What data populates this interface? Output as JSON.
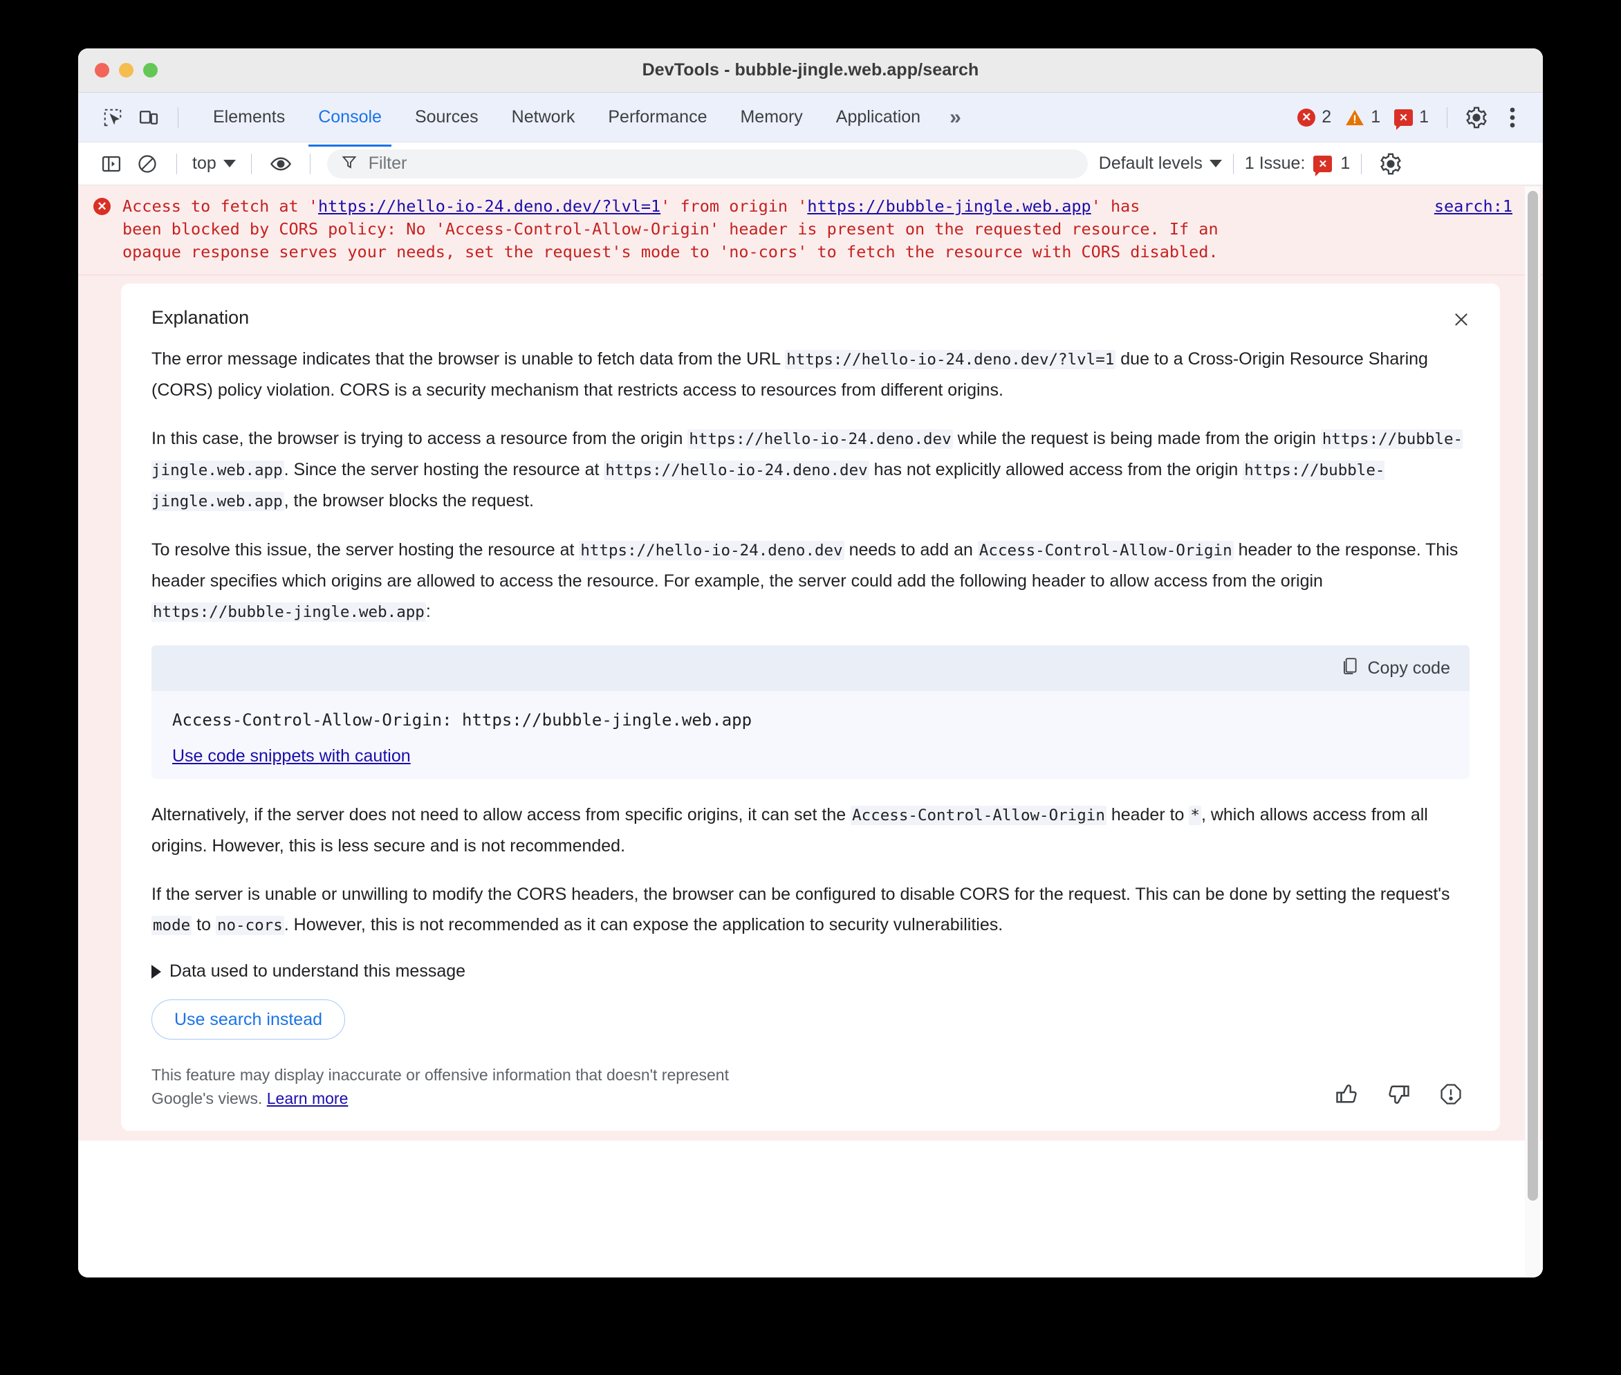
{
  "window": {
    "title": "DevTools - bubble-jingle.web.app/search",
    "traffic_lights": [
      "close",
      "minimize",
      "zoom"
    ]
  },
  "tabbar": {
    "icons": [
      "inspect-element-icon",
      "device-toolbar-icon"
    ],
    "tabs": [
      {
        "label": "Elements",
        "active": false
      },
      {
        "label": "Console",
        "active": true
      },
      {
        "label": "Sources",
        "active": false
      },
      {
        "label": "Network",
        "active": false
      },
      {
        "label": "Performance",
        "active": false
      },
      {
        "label": "Memory",
        "active": false
      },
      {
        "label": "Application",
        "active": false
      }
    ],
    "overflow": "»",
    "counters": {
      "errors": "2",
      "warnings": "1",
      "issues": "1",
      "error_glyph": "✕",
      "issue_glyph": "✕"
    },
    "settings_icon": "gear-icon",
    "more_icon": "kebab-menu-icon"
  },
  "console_toolbar": {
    "sidebar_toggle": "show-console-sidebar-icon",
    "clear_console": "clear-console-icon",
    "context": "top",
    "eye_icon": "live-expression-icon",
    "filter_placeholder": "Filter",
    "filter_value": "",
    "levels": "Default levels",
    "issues_text": "1 Issue:",
    "issues_count": "1",
    "settings_icon": "gear-icon"
  },
  "console_message": {
    "line1_pre": "Access to fetch at '",
    "link1": "https://hello-io-24.deno.dev/?lvl=1",
    "line1_mid": "' from origin '",
    "link2": "https://bubble-jingle.web.app",
    "line1_post": "' has",
    "line2": "been blocked by CORS policy: No 'Access-Control-Allow-Origin' header is present on the requested resource. If an",
    "line3": "opaque response serves your needs, set the request's mode to 'no-cors' to fetch the resource with CORS disabled.",
    "source_link": "search:1"
  },
  "insight": {
    "title": "Explanation",
    "close_label": "×",
    "p1_a": "The error message indicates that the browser is unable to fetch data from the URL ",
    "p1_code": "https://hello-io-24.deno.dev/?lvl=1",
    "p1_b": " due to a Cross-Origin Resource Sharing (CORS) policy violation. CORS is a security mechanism that restricts access to resources from different origins.",
    "p2_a": "In this case, the browser is trying to access a resource from the origin ",
    "p2_code1": "https://hello-io-24.deno.dev",
    "p2_b": " while the request is being made from the origin ",
    "p2_code2": "https://bubble-jingle.web.app",
    "p2_c": ". Since the server hosting the resource at ",
    "p2_code3": "https://hello-io-24.deno.dev",
    "p2_d": " has not explicitly allowed access from the origin ",
    "p2_code4": "https://bubble-jingle.web.app",
    "p2_e": ", the browser blocks the request.",
    "p3_a": "To resolve this issue, the server hosting the resource at ",
    "p3_code1": "https://hello-io-24.deno.dev",
    "p3_b": " needs to add an ",
    "p3_code2": "Access-Control-Allow-Origin",
    "p3_c": " header to the response. This header specifies which origins are allowed to access the resource. For example, the server could add the following header to allow access from the origin ",
    "p3_code3": "https://bubble-jingle.web.app",
    "p3_d": ":",
    "code_block": {
      "copy_label": "Copy code",
      "copy_icon": "copy-icon",
      "content": "Access-Control-Allow-Origin: https://bubble-jingle.web.app",
      "caution_link": "Use code snippets with caution"
    },
    "p4_a": "Alternatively, if the server does not need to allow access from specific origins, it can set the ",
    "p4_code1": "Access-Control-Allow-Origin",
    "p4_b": " header to ",
    "p4_code2": "*",
    "p4_c": ", which allows access from all origins. However, this is less secure and is not recommended.",
    "p5_a": "If the server is unable or unwilling to modify the CORS headers, the browser can be configured to disable CORS for the request. This can be done by setting the request's ",
    "p5_code1": "mode",
    "p5_b": " to ",
    "p5_code2": "no-cors",
    "p5_c": ". However, this is not recommended as it can expose the application to security vulnerabilities.",
    "data_used_label": "Data used to understand this message",
    "search_button": "Use search instead",
    "disclaimer_text": "This feature may display inaccurate or offensive information that doesn't represent Google's views. ",
    "disclaimer_link": "Learn more",
    "feedback_icons": [
      "thumb-up-icon",
      "thumb-down-icon",
      "report-icon"
    ]
  },
  "colors": {
    "accent": "#1a73e8",
    "error": "#d93025",
    "warning": "#e37400",
    "error_bg": "#fceded",
    "link": "#1a0dab"
  }
}
